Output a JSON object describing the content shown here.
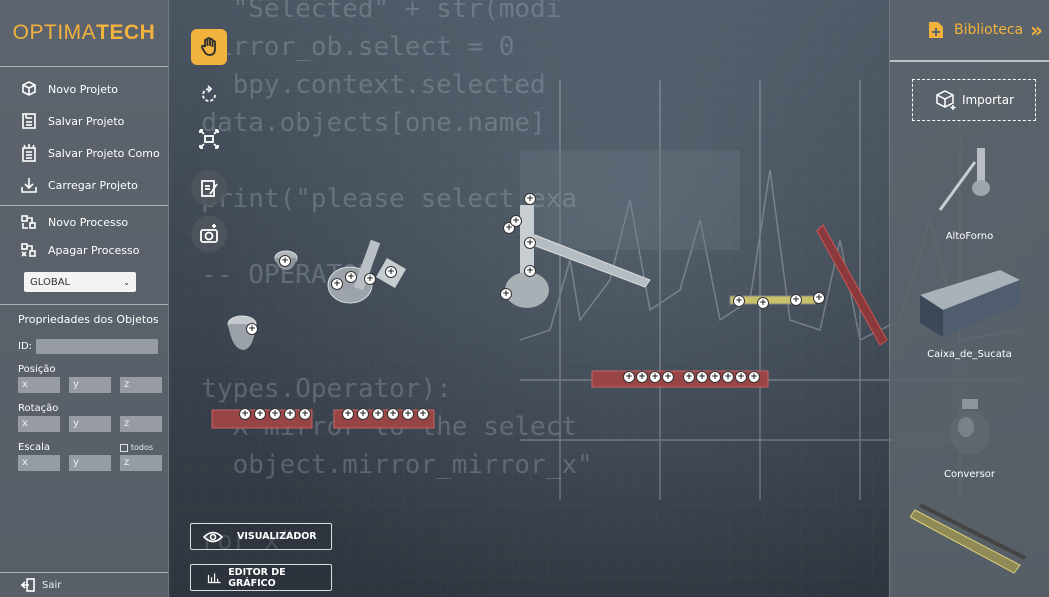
{
  "logo": {
    "part1": "OPTIMA",
    "part2": "TECH"
  },
  "menu": {
    "novo_projeto": "Novo Projeto",
    "salvar_projeto": "Salvar Projeto",
    "salvar_projeto_como": "Salvar Projeto Como",
    "carregar_projeto": "Carregar Projeto",
    "novo_processo": "Novo Processo",
    "apagar_processo": "Apagar Processo"
  },
  "process_select": {
    "value": "GLOBAL"
  },
  "properties": {
    "title": "Propriedades dos Objetos",
    "id_label": "ID:",
    "position_label": "Posição",
    "rotation_label": "Rotação",
    "scale_label": "Escala",
    "all_label": "todos",
    "x": "x",
    "y": "y",
    "z": "z"
  },
  "exit_label": "Sair",
  "bottom_buttons": {
    "viewer": "VISUALIZADOR",
    "chart_editor": "EDITOR DE GRÁFICO"
  },
  "library": {
    "title": "Biblioteca",
    "import": "Importar",
    "items": [
      "AltoForno",
      "Caixa_de_Sucata",
      "Conversor"
    ]
  },
  "colors": {
    "accent": "#f2b23e",
    "panel": "#5c646c"
  },
  "icons": {
    "tools": [
      "hand-icon",
      "rotate-icon",
      "scale-icon",
      "clipboard-icon",
      "camera-icon"
    ]
  }
}
